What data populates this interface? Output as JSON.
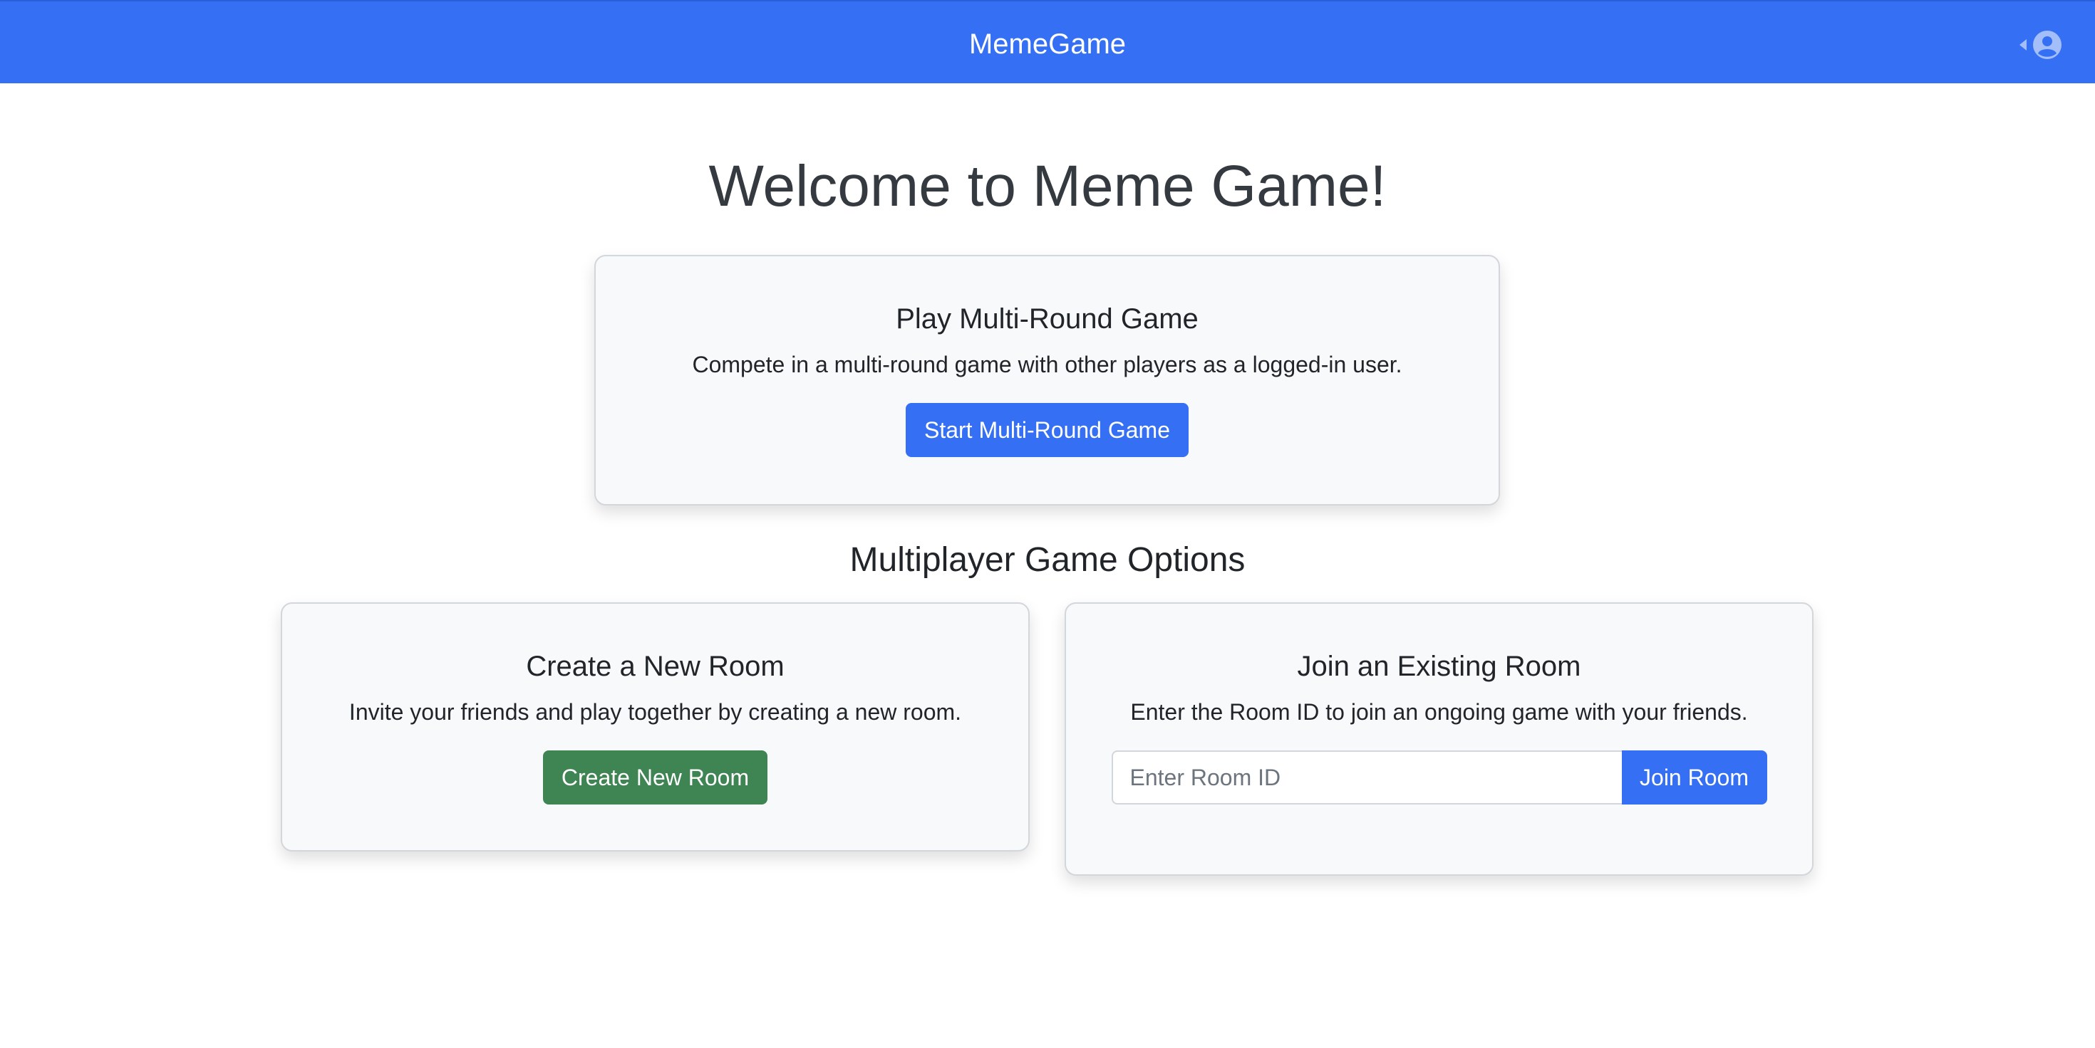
{
  "navbar": {
    "brand": "MemeGame",
    "user_icon": "user-circle-icon",
    "caret_icon": "caret-left-icon"
  },
  "welcome": {
    "title": "Welcome to Meme Game!"
  },
  "multi_round": {
    "title": "Play Multi-Round Game",
    "description": "Compete in a multi-round game with other players as a logged-in user.",
    "button_label": "Start Multi-Round Game"
  },
  "multiplayer": {
    "section_title": "Multiplayer Game Options",
    "create": {
      "title": "Create a New Room",
      "description": "Invite your friends and play together by creating a new room.",
      "button_label": "Create New Room"
    },
    "join": {
      "title": "Join an Existing Room",
      "description": "Enter the Room ID to join an ongoing game with your friends.",
      "input_value": "",
      "input_placeholder": "Enter Room ID",
      "button_label": "Join Room"
    }
  },
  "colors": {
    "primary": "#3570f4",
    "success": "#3f8453",
    "card_bg": "#f8f9fa",
    "heading": "#343a40"
  }
}
